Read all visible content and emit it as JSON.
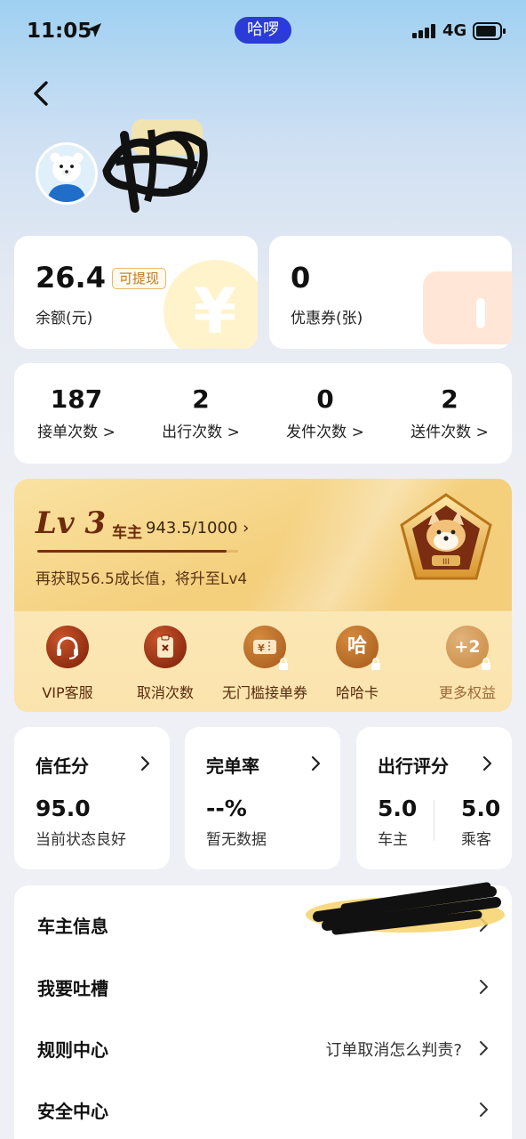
{
  "status_bar": {
    "time": "11:05",
    "app_pill": "哈啰",
    "network": "4G"
  },
  "balance": {
    "amount": "26.4",
    "withdraw_badge": "可提现",
    "label": "余额(元)"
  },
  "coupons": {
    "count": "0",
    "label": "优惠券(张)"
  },
  "counts": [
    {
      "value": "187",
      "label": "接单次数 >"
    },
    {
      "value": "2",
      "label": "出行次数 >"
    },
    {
      "value": "0",
      "label": "发件次数 >"
    },
    {
      "value": "2",
      "label": "送件次数 >"
    }
  ],
  "level": {
    "title": "Lv 3",
    "suffix": "车主",
    "progress_text": "943.5/1000",
    "progress_fraction": 0.9435,
    "tip": "再获取56.5成长值，将升至Lv4",
    "perks": [
      {
        "label": "VIP客服",
        "icon": "headset-icon",
        "locked": false
      },
      {
        "label": "取消次数",
        "icon": "clipboard-x-icon",
        "locked": false
      },
      {
        "label": "无门槛接单券",
        "icon": "yen-ticket-icon",
        "locked": true
      },
      {
        "label": "哈哈卡",
        "icon": "ha-card-icon",
        "icon_text": "哈",
        "locked": true
      },
      {
        "label": "更多权益",
        "icon": "plus-two-icon",
        "icon_text": "+2",
        "locked": true
      }
    ]
  },
  "stats": {
    "trust": {
      "title": "信任分",
      "value": "95.0",
      "desc": "当前状态良好"
    },
    "completion": {
      "title": "完单率",
      "value": "--%",
      "desc": "暂无数据"
    },
    "rating": {
      "title": "出行评分",
      "driver_value": "5.0",
      "driver_label": "车主",
      "passenger_value": "5.0",
      "passenger_label": "乘客"
    }
  },
  "menu": [
    {
      "label": "车主信息",
      "hint": ""
    },
    {
      "label": "我要吐槽",
      "hint": ""
    },
    {
      "label": "规则中心",
      "hint": "订单取消怎么判责?"
    },
    {
      "label": "安全中心",
      "hint": ""
    }
  ],
  "colors": {
    "pill_bg": "#2a3bd8",
    "level_brown": "#6e2b0c",
    "gold": "#f4cf7c",
    "badge_orange": "#c07a20"
  }
}
